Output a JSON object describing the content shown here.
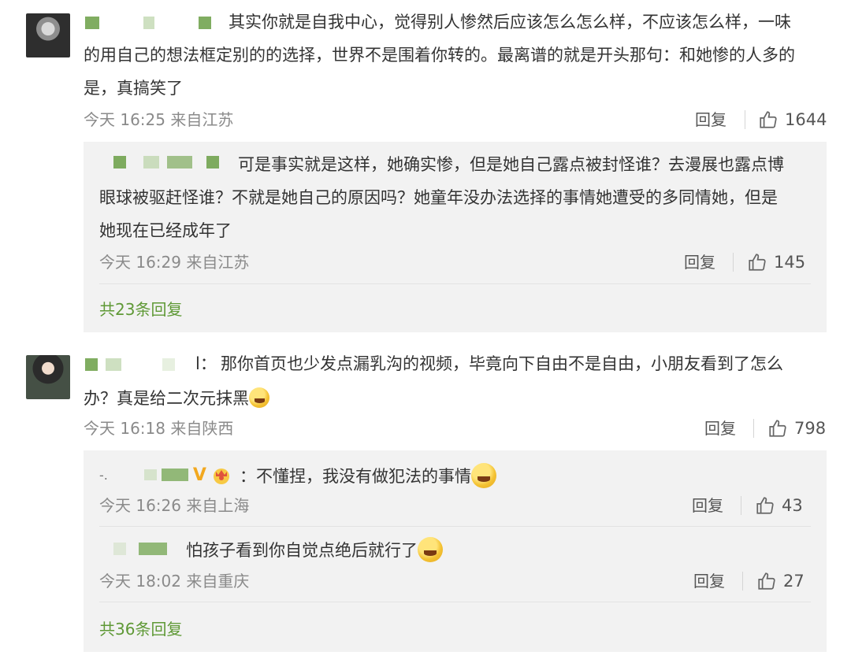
{
  "comments": [
    {
      "text": "其实你就是自我中心，觉得别人惨然后应该怎么怎么样，不应该怎么样，一味的用自己的想法框定别的的选择，世界不是围着你转的。最离谱的就是开头那句：和她惨的人多的是，真搞笑了",
      "line1": "其实你就是自我中心，觉得别人惨然后应该怎么怎么样，不应该怎么样，一味",
      "line2": "的用自己的想法框定别的的选择，世界不是围着你转的。最离谱的就是开头那句：和她惨的人多的",
      "line3": "是，真搞笑了",
      "meta": "今天 16:25 来自江苏",
      "reply_label": "回复",
      "likes": "1644",
      "replies": [
        {
          "line1": "可是事实就是这样，她确实惨，但是她自己露点被封怪谁？去漫展也露点博",
          "line2": "眼球被驱赶怪谁？不就是她自己的原因吗？她童年没办法选择的事情她遭受的多同情她，但是",
          "line3": "她现在已经成年了",
          "meta": "今天 16:29 来自江苏",
          "reply_label": "回复",
          "likes": "145"
        }
      ],
      "more_replies": "共23条回复"
    },
    {
      "name_tail": "l：",
      "line1": "那你首页也少发点漏乳沟的视频，毕竟向下自由不是自由，小朋友看到了怎么",
      "line2": "办？真是给二次元抹黑",
      "meta": "今天 16:18 来自陕西",
      "reply_label": "回复",
      "likes": "798",
      "replies": [
        {
          "name_prefix": "-.",
          "text": "：不懂捏，我没有做犯法的事情",
          "meta": "今天 16:26 来自上海",
          "reply_label": "回复",
          "likes": "43"
        },
        {
          "text": "怕孩子看到你自觉点绝后就行了",
          "meta": "今天 18:02 来自重庆",
          "reply_label": "回复",
          "likes": "27"
        }
      ],
      "more_replies": "共36条回复"
    }
  ],
  "colors": {
    "accent_green": "#5f9936",
    "meta_gray": "#8a8a8a",
    "reply_bg": "#f2f2f2"
  },
  "icons": {
    "like": "thumbs-up-icon",
    "vip": "v-badge-icon",
    "crown": "crown-icon",
    "emoji": "grin-emoji-icon"
  }
}
